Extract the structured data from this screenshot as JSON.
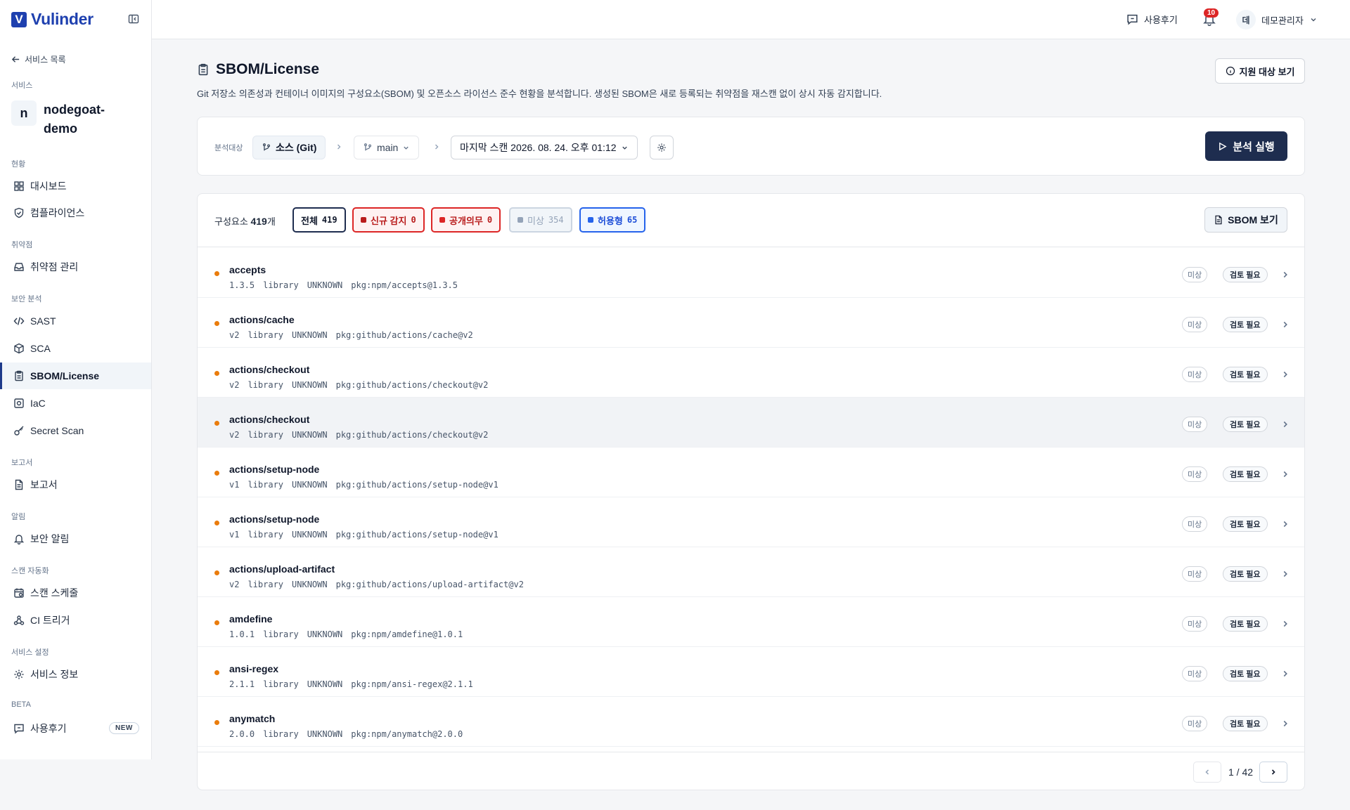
{
  "brand": {
    "logo_letter": "V",
    "name": "Vulinder"
  },
  "sidebar": {
    "back_label": "서비스 목록",
    "service_label": "서비스",
    "service_avatar": "n",
    "service_name": "nodegoat-demo",
    "sections": {
      "status": "현황",
      "vuln": "취약점",
      "security": "보안 분석",
      "report": "보고서",
      "alert": "알림",
      "automation": "스캔 자동화",
      "settings": "서비스 설정",
      "beta": "BETA"
    },
    "items": {
      "dashboard": "대시보드",
      "compliance": "컴플라이언스",
      "vuln_mgmt": "취약점 관리",
      "sast": "SAST",
      "sca": "SCA",
      "sbom": "SBOM/License",
      "iac": "IaC",
      "secret": "Secret Scan",
      "report": "보고서",
      "sec_alert": "보안 알림",
      "schedule": "스캔 스케줄",
      "ci": "CI 트리거",
      "svc_info": "서비스 정보",
      "feedback": "사용후기"
    },
    "new_badge": "NEW",
    "active_item": "SBOM/License"
  },
  "topbar": {
    "feedback_label": "사용후기",
    "bell_count": "10",
    "user_avatar": "데",
    "user_name": "데모관리자"
  },
  "page": {
    "title": "SBOM/License",
    "description": "Git 저장소 의존성과 컨테이너 이미지의 구성요소(SBOM) 및 오픈소스 라이선스 준수 현황을 분석합니다. 생성된 SBOM은 새로 등록되는 취약점을 재스캔 없이 상시 자동 감지합니다.",
    "support_button": "지원 대상 보기"
  },
  "target": {
    "label": "분석대상",
    "source": "소스 (Git)",
    "branch": "main",
    "last_scan": "마지막 스캔 2026. 08. 24. 오후 01:12",
    "run_button": "분석 실행"
  },
  "components": {
    "count_label": "구성요소",
    "count_value": "419",
    "count_unit": "개",
    "filters": [
      {
        "label": "전체",
        "count": "419"
      },
      {
        "label": "신규 감지",
        "count": "0"
      },
      {
        "label": "공개의무",
        "count": "0"
      },
      {
        "label": "미상",
        "count": "354"
      },
      {
        "label": "허용형",
        "count": "65"
      }
    ],
    "sbom_button": "SBOM 보기",
    "rows": [
      {
        "name": "accepts",
        "version": "1.3.5",
        "type": "library",
        "license": "UNKNOWN",
        "purl": "pkg:npm/accepts@1.3.5",
        "status": "미상",
        "review": "검토 필요"
      },
      {
        "name": "actions/cache",
        "version": "v2",
        "type": "library",
        "license": "UNKNOWN",
        "purl": "pkg:github/actions/cache@v2",
        "status": "미상",
        "review": "검토 필요"
      },
      {
        "name": "actions/checkout",
        "version": "v2",
        "type": "library",
        "license": "UNKNOWN",
        "purl": "pkg:github/actions/checkout@v2",
        "status": "미상",
        "review": "검토 필요"
      },
      {
        "name": "actions/checkout",
        "version": "v2",
        "type": "library",
        "license": "UNKNOWN",
        "purl": "pkg:github/actions/checkout@v2",
        "status": "미상",
        "review": "검토 필요"
      },
      {
        "name": "actions/setup-node",
        "version": "v1",
        "type": "library",
        "license": "UNKNOWN",
        "purl": "pkg:github/actions/setup-node@v1",
        "status": "미상",
        "review": "검토 필요"
      },
      {
        "name": "actions/setup-node",
        "version": "v1",
        "type": "library",
        "license": "UNKNOWN",
        "purl": "pkg:github/actions/setup-node@v1",
        "status": "미상",
        "review": "검토 필요"
      },
      {
        "name": "actions/upload-artifact",
        "version": "v2",
        "type": "library",
        "license": "UNKNOWN",
        "purl": "pkg:github/actions/upload-artifact@v2",
        "status": "미상",
        "review": "검토 필요"
      },
      {
        "name": "amdefine",
        "version": "1.0.1",
        "type": "library",
        "license": "UNKNOWN",
        "purl": "pkg:npm/amdefine@1.0.1",
        "status": "미상",
        "review": "검토 필요"
      },
      {
        "name": "ansi-regex",
        "version": "2.1.1",
        "type": "library",
        "license": "UNKNOWN",
        "purl": "pkg:npm/ansi-regex@2.1.1",
        "status": "미상",
        "review": "검토 필요"
      },
      {
        "name": "anymatch",
        "version": "2.0.0",
        "type": "library",
        "license": "UNKNOWN",
        "purl": "pkg:npm/anymatch@2.0.0",
        "status": "미상",
        "review": "검토 필요"
      }
    ],
    "pagination": "1 / 42"
  },
  "colors": {
    "brand": "#1e40af",
    "run_button": "#1e2d4f",
    "unknown_dot": "#ea7c0c",
    "new_filter": "#dc2626",
    "permissive_filter": "#2563eb"
  }
}
